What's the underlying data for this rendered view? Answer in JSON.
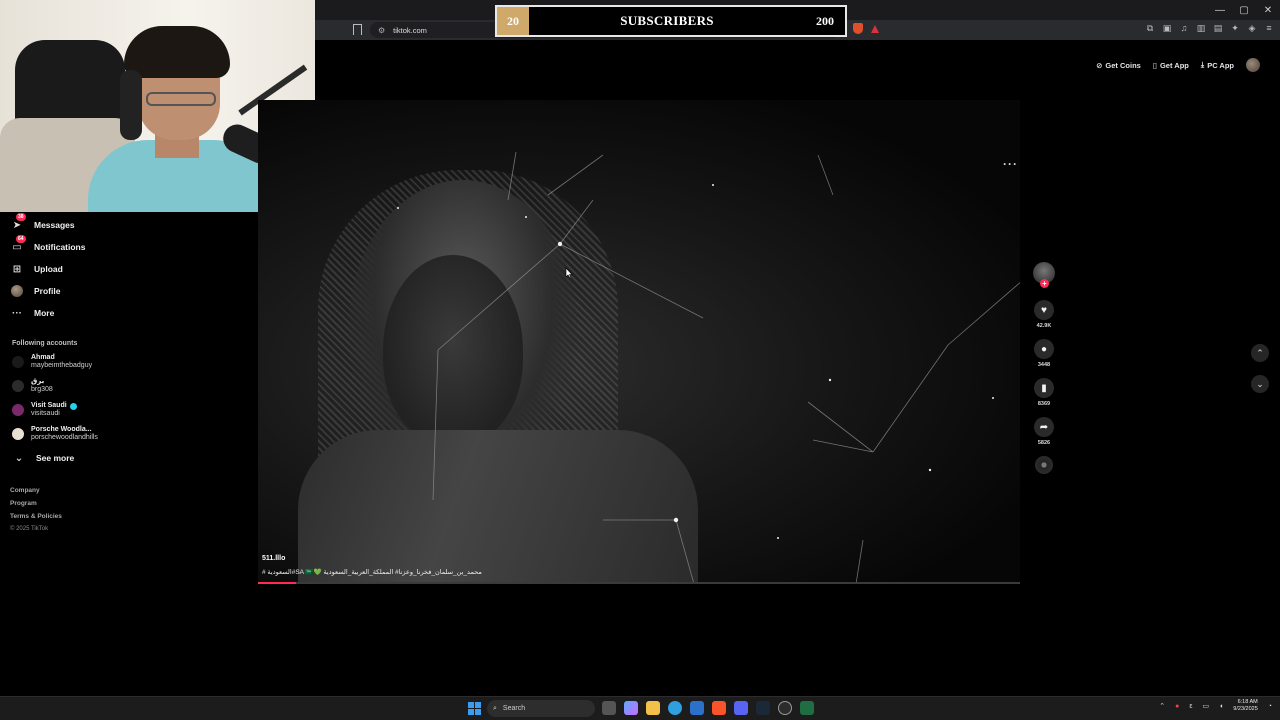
{
  "browser": {
    "url": "tiktok.com",
    "window_controls": [
      "—",
      "▢",
      "✕"
    ]
  },
  "subscriber_goal": {
    "current": "20",
    "label": "SUBSCRIBERS",
    "target": "200",
    "fill_fraction": 0.1
  },
  "tiktok_header": {
    "get_coins": "Get Coins",
    "get_app": "Get App",
    "pc_app": "PC App"
  },
  "sidebar": {
    "nav": [
      {
        "label": "Messages",
        "icon": "paper-plane-icon",
        "badge": "38"
      },
      {
        "label": "Notifications",
        "icon": "inbox-icon",
        "badge": "64"
      },
      {
        "label": "Upload",
        "icon": "plus-square-icon"
      },
      {
        "label": "Profile",
        "icon": "avatar-icon"
      },
      {
        "label": "More",
        "icon": "dots-icon"
      }
    ],
    "following_title": "Following accounts",
    "accounts": [
      {
        "name": "Ahmad",
        "handle": "maybeimthebadguy",
        "avatar_color": "#1a1a1a"
      },
      {
        "name": "برق",
        "handle": "brg308",
        "avatar_color": "#2b2b2b"
      },
      {
        "name": "Visit Saudi",
        "handle": "visitsaudi",
        "verified": true,
        "avatar_color": "#7a2a6a"
      },
      {
        "name": "Porsche Woodla...",
        "handle": "porschewoodlandhills",
        "avatar_color": "#e8e0d0"
      }
    ],
    "see_more": "See more",
    "footer": [
      "Company",
      "Program",
      "Terms & Policies"
    ],
    "copyright": "© 2025 TikTok"
  },
  "video": {
    "author": "511.lllo",
    "caption": "# السعودية#SA 🇸🇦💚 محمد_بن_سلمان_فخرنا_وعزنا# المملكة_العربية_السعودية",
    "progress_fraction": 0.05,
    "likes": "42.9K",
    "comments": "3448",
    "saves": "8369",
    "shares": "5826"
  },
  "taskbar": {
    "search_placeholder": "Search",
    "time": "6:18 AM",
    "date": "9/23/2025"
  },
  "colors": {
    "accent": "#fe2c55",
    "goal_fill": "#cfa96a"
  }
}
